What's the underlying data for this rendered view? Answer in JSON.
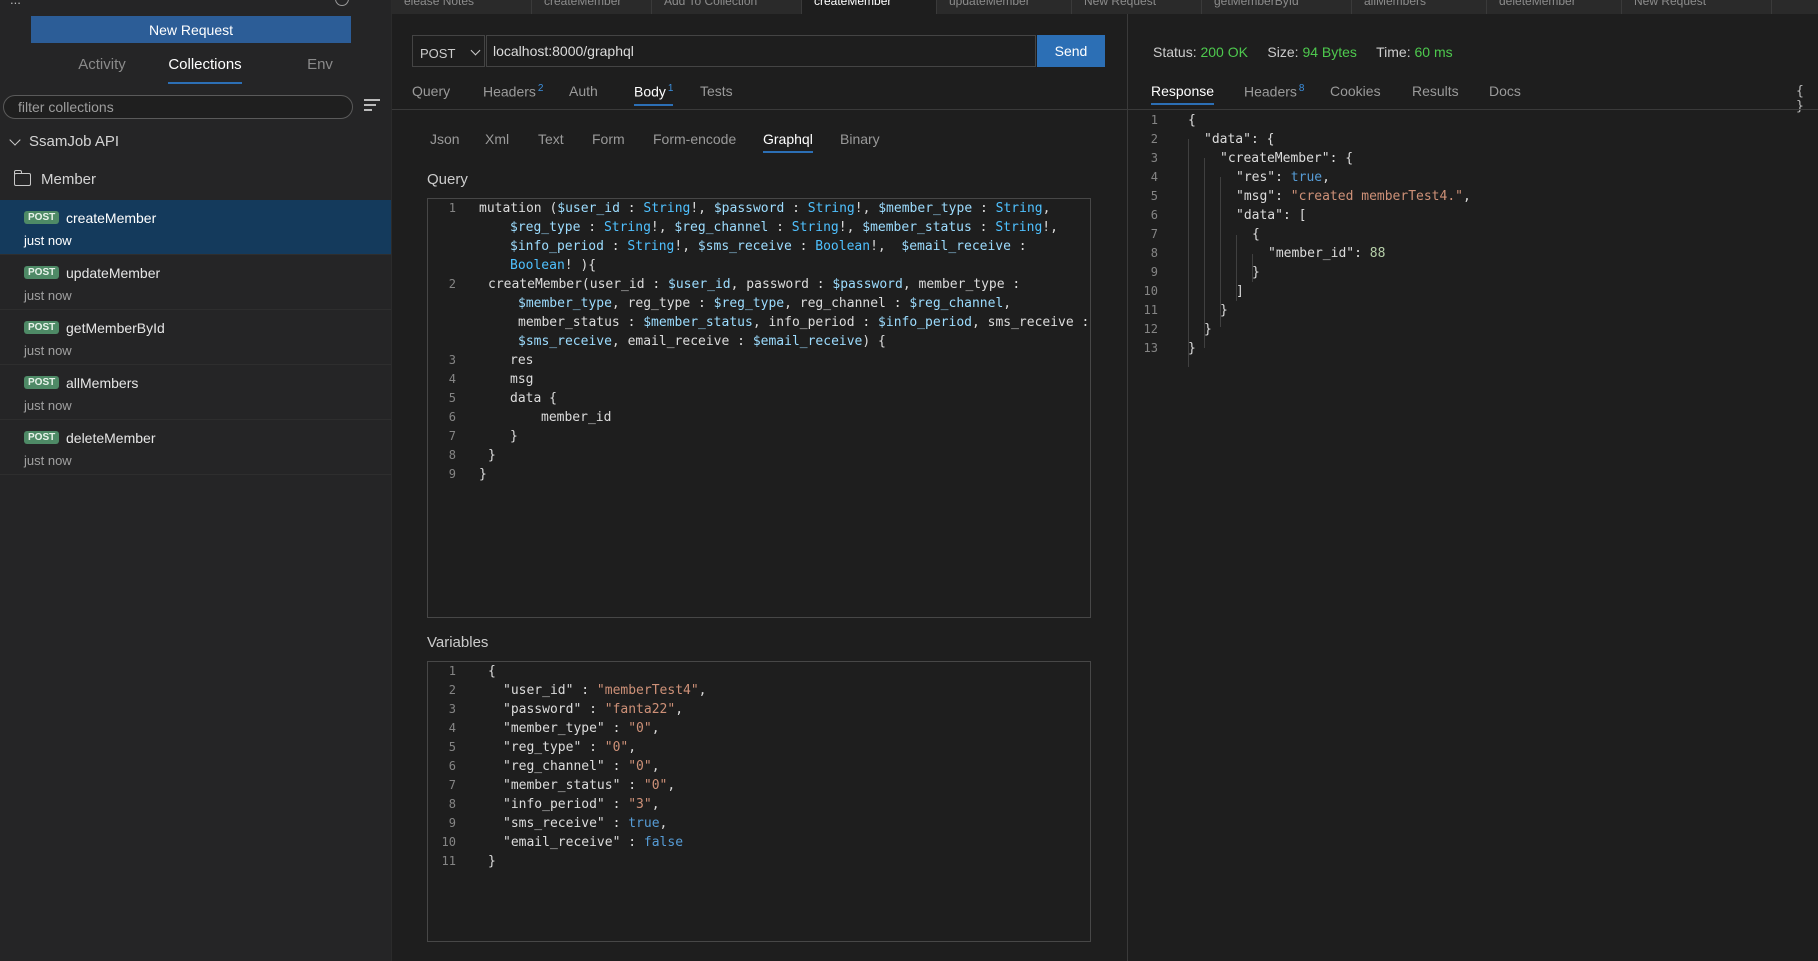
{
  "sidebar": {
    "top_cut_text": "...",
    "new_request_label": "New Request",
    "tabs": [
      "Activity",
      "Collections",
      "Env"
    ],
    "filter_placeholder": "filter collections",
    "collection_name": "SsamJob API",
    "folder_name": "Member",
    "requests": [
      {
        "method": "POST",
        "name": "createMember",
        "time": "just now"
      },
      {
        "method": "POST",
        "name": "updateMember",
        "time": "just now"
      },
      {
        "method": "POST",
        "name": "getMemberById",
        "time": "just now"
      },
      {
        "method": "POST",
        "name": "allMembers",
        "time": "just now"
      },
      {
        "method": "POST",
        "name": "deleteMember",
        "time": "just now"
      }
    ]
  },
  "top_tabs": [
    "elease Notes",
    "createMember",
    "Add To Collection",
    "createMember",
    "updateMember",
    "New Request",
    "getMemberById",
    "allMembers",
    "deleteMember",
    "New Request"
  ],
  "request": {
    "method": "POST",
    "url": "localhost:8000/graphql",
    "send_label": "Send",
    "tabs": {
      "query": "Query",
      "headers": "Headers",
      "headers_count": "2",
      "auth": "Auth",
      "body": "Body",
      "body_count": "1",
      "tests": "Tests"
    },
    "body_tabs": [
      "Json",
      "Xml",
      "Text",
      "Form",
      "Form-encode",
      "Graphql",
      "Binary"
    ],
    "query_label": "Query",
    "variables_label": "Variables"
  },
  "response": {
    "status_label": "Status:",
    "status_value": "200 OK",
    "size_label": "Size:",
    "size_value": "94 Bytes",
    "time_label": "Time:",
    "time_value": "60 ms",
    "tabs": {
      "response": "Response",
      "headers": "Headers",
      "headers_count": "8",
      "cookies": "Cookies",
      "results": "Results",
      "docs": "Docs"
    },
    "braces_icon": "{ }"
  },
  "colors": {
    "accent": "#2c6fb5",
    "new_request_bg": "#2c5d97",
    "active_item_bg": "#143a5c",
    "post_badge": "#4e8a66",
    "status_green": "#4ec94e"
  }
}
